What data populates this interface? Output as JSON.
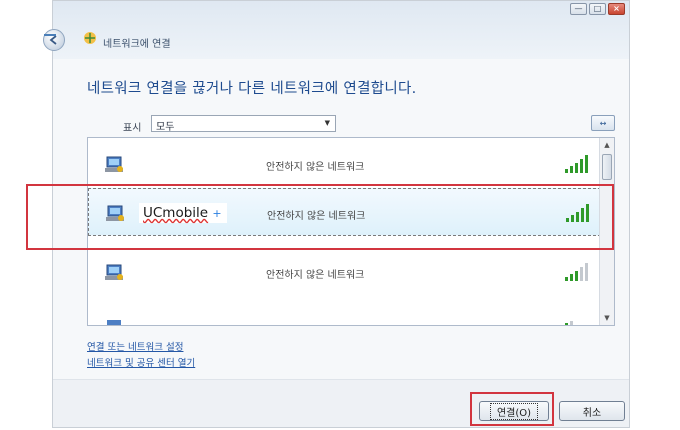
{
  "window": {
    "title": "네트워크에 연결",
    "controls": {
      "minimize": "—",
      "maximize": "□",
      "close": "×"
    }
  },
  "heading": "네트워크 연결을 끊거나 다른 네트워크에 연결합니다.",
  "filter": {
    "label": "표시",
    "value": "모두"
  },
  "refresh_symbol": "↔",
  "networks": [
    {
      "ssid": "",
      "description": "안전하지 않은 네트워크",
      "signal_bars": 5
    },
    {
      "ssid": "UCmobile",
      "ssid_mark": "+",
      "description": "안전하지 않은 네트워크",
      "signal_bars": 5,
      "selected": true
    },
    {
      "ssid": "",
      "description": "안전하지 않은 네트워크",
      "signal_bars": 3
    },
    {
      "ssid": "",
      "description": "",
      "signal_bars": 1
    }
  ],
  "links": {
    "setup": "연결 또는 네트워크 설정",
    "sharing_center": "네트워크 및 공유 센터 열기"
  },
  "buttons": {
    "connect": "연결(O)",
    "cancel": "취소"
  },
  "colors": {
    "highlight": "#d2353f",
    "link": "#2457a6",
    "heading": "#1e4b8f",
    "signal": "#2f9a2a"
  }
}
